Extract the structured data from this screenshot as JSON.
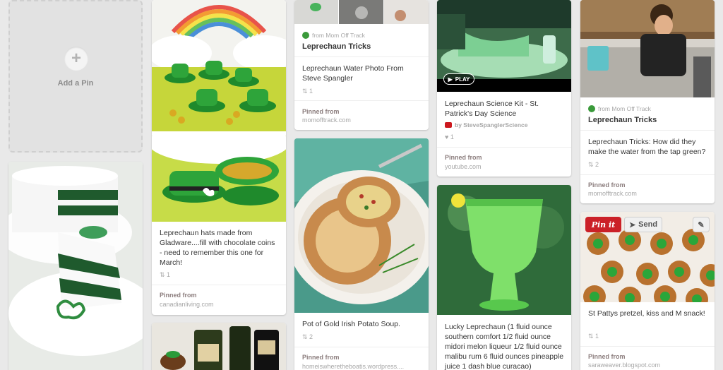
{
  "add_pin": {
    "label": "Add a Pin",
    "plus": "+"
  },
  "pins": {
    "p1": {
      "caption": "Leprechaun hats made from Gladware....fill with chocolate coins - need to remember this one for March!",
      "repins": "1",
      "pinned_from_label": "Pinned from",
      "source": "canadianliving.com"
    },
    "p2": {
      "from_text": "from Mom Off Track",
      "board_title": "Leprechaun Tricks",
      "caption": "Leprechaun Water Photo From Steve Spangler",
      "repins": "1",
      "pinned_from_label": "Pinned from",
      "source": "momofftrack.com"
    },
    "p3": {
      "caption": "Pot of Gold Irish Potato Soup.",
      "repins": "2",
      "pinned_from_label": "Pinned from",
      "source": "homeiswheretheboatis.wordpress...."
    },
    "p4": {
      "play_label": "PLAY",
      "caption": "Leprechaun Science Kit - St. Patrick's Day Science",
      "by_text": "by SteveSpanglerScience",
      "likes": "1",
      "pinned_from_label": "Pinned from",
      "source": "youtube.com"
    },
    "p5": {
      "caption": "Lucky Leprechaun (1 fluid ounce southern comfort 1/2 fluid ounce midori melon liqueur 1/2 fluid ounce malibu rum 6 fluid ounces pineapple juice 1 dash blue curacao)"
    },
    "p6": {
      "from_text": "from Mom Off Track",
      "board_title": "Leprechaun Tricks",
      "caption": "Leprechaun Tricks: How did they make the water from the tap green?",
      "repins": "2",
      "pinned_from_label": "Pinned from",
      "source": "momofftrack.com"
    },
    "p7": {
      "pinit_label": "Pin it",
      "send_label": "Send",
      "caption": "St Pattys pretzel, kiss and M snack!",
      "repins": "1",
      "pinned_from_label": "Pinned from",
      "source": "saraweaver.blogspot.com"
    }
  },
  "icons": {
    "repin": "repin-icon",
    "like": "heart-icon",
    "youtube": "youtube-icon",
    "edit": "pencil-icon",
    "send": "paper-plane-icon",
    "board": "clover-icon",
    "add": "plus-icon"
  },
  "colors": {
    "background": "#e9e9e9",
    "pinit_red": "#cb2027",
    "green": "#3a9a3a"
  }
}
